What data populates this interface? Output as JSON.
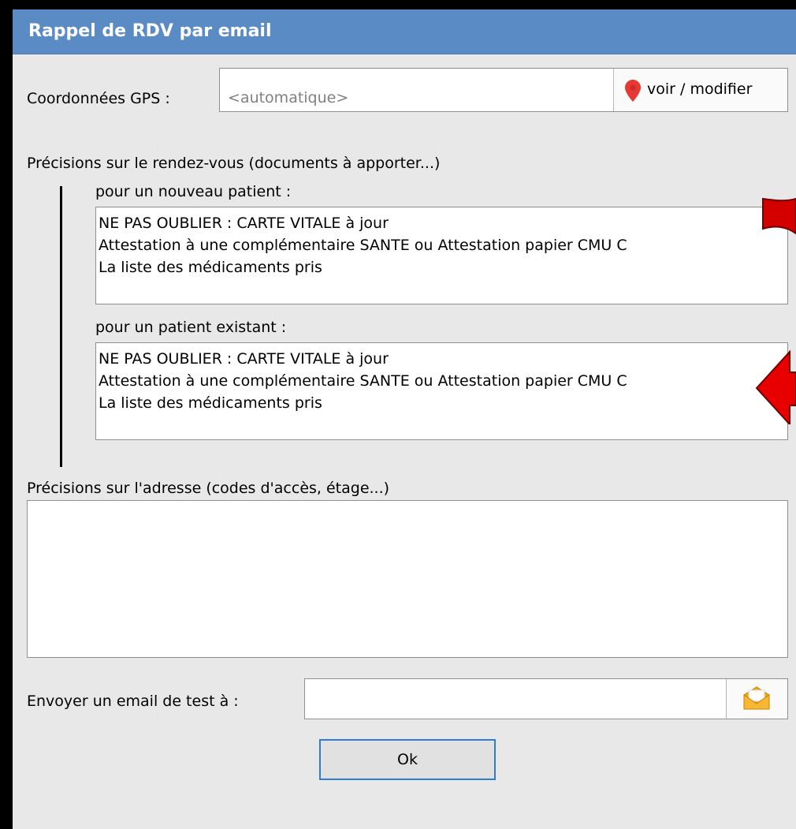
{
  "window": {
    "title": "Rappel de RDV par email"
  },
  "gps": {
    "label": "Coordonnées GPS :",
    "placeholder": "<automatique>",
    "button_label": "voir / modifier",
    "button_icon": "map-pin-icon",
    "pin_color": "#e53935"
  },
  "precisions_rdv": {
    "heading": "Précisions sur le rendez-vous (documents à apporter...)",
    "new_patient": {
      "label": "pour un nouveau patient :",
      "lines": [
        "NE PAS OUBLIER : CARTE VITALE à jour",
        "Attestation à une complémentaire SANTE ou Attestation papier CMU C",
        "La liste des médicaments pris"
      ]
    },
    "existing_patient": {
      "label": "pour un patient existant :",
      "lines": [
        "NE PAS OUBLIER : CARTE VITALE à jour",
        "Attestation à une complémentaire SANTE ou Attestation papier CMU C",
        "La liste des médicaments pris"
      ]
    }
  },
  "address": {
    "label": "Précisions sur l'adresse (codes d'accès, étage...)",
    "value": ""
  },
  "test_email": {
    "label": "Envoyer un email de test à :",
    "value": "",
    "button_icon": "envelope-icon"
  },
  "ok_button": {
    "label": "Ok"
  },
  "annotation_color": "#d40000"
}
